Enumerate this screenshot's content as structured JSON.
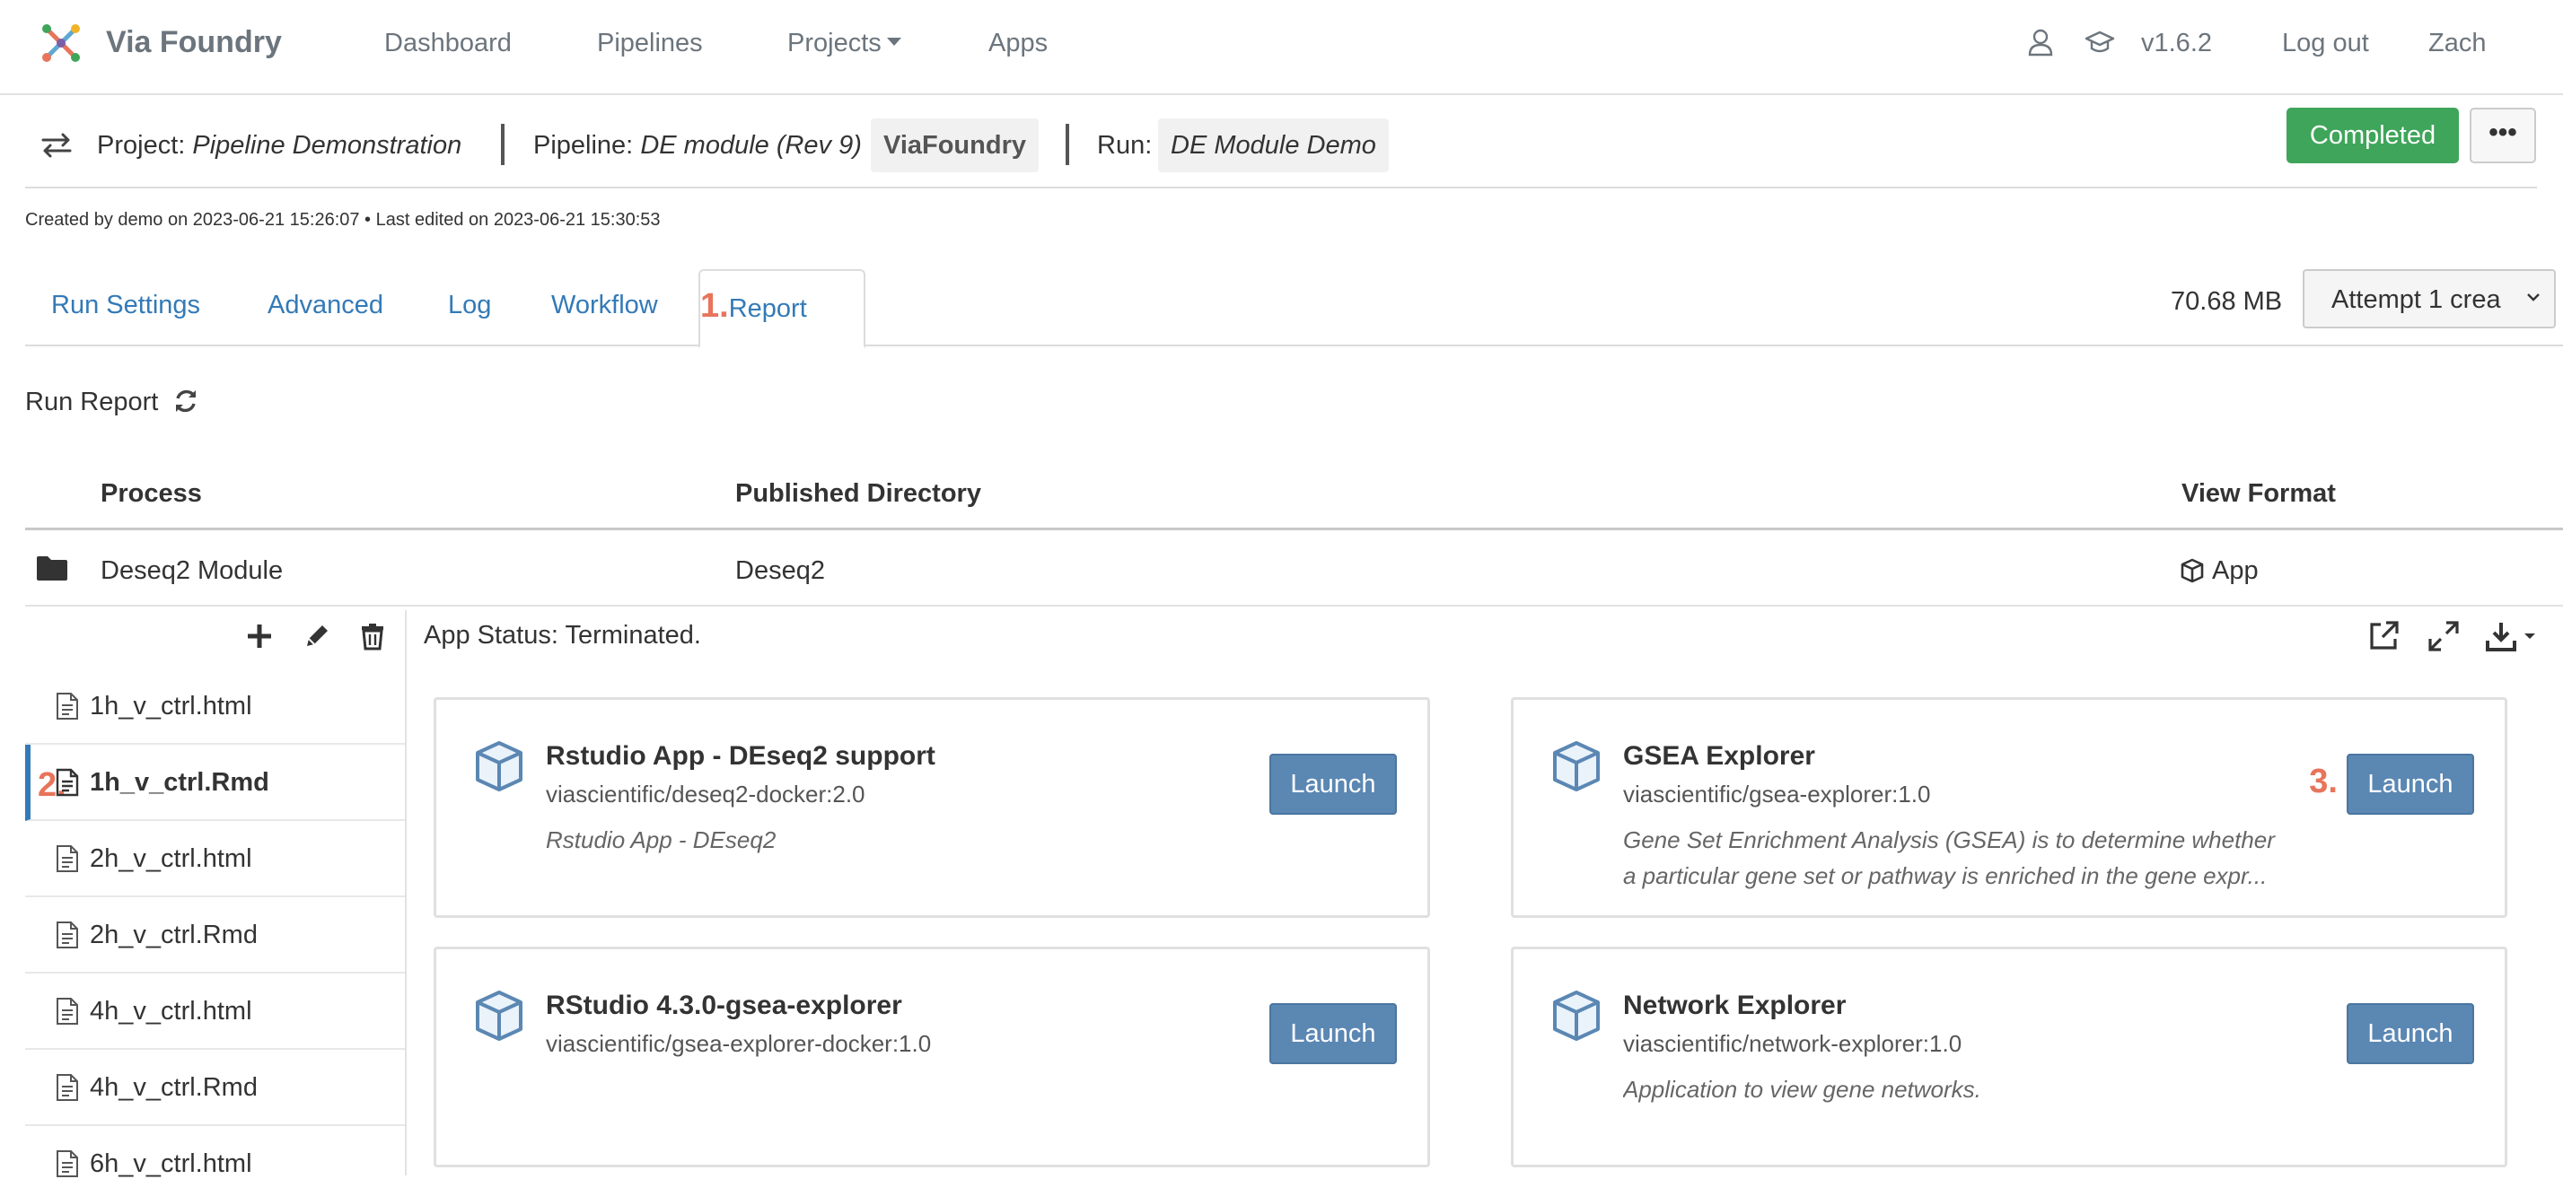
{
  "nav": {
    "brand": "Via Foundry",
    "links": [
      "Dashboard",
      "Pipelines",
      "Projects",
      "Apps"
    ],
    "version": "v1.6.2",
    "logout": "Log out",
    "user": "Zach"
  },
  "project": {
    "project_label": "Project:",
    "project_name": "Pipeline Demonstration",
    "pipeline_label": "Pipeline:",
    "pipeline_name": "DE module (Rev 9)",
    "pipeline_owner": "ViaFoundry",
    "run_label": "Run:",
    "run_name": "DE Module Demo",
    "status": "Completed",
    "more": "•••",
    "meta": "Created by demo on 2023-06-21 15:26:07 • Last edited on 2023-06-21 15:30:53"
  },
  "tabs": [
    "Run Settings",
    "Advanced",
    "Log",
    "Workflow",
    "Report"
  ],
  "markers": {
    "tab": "1.",
    "file": "2.",
    "launch": "3."
  },
  "size": "70.68 MB",
  "attempt": "Attempt 1 crea",
  "report": {
    "title": "Run Report",
    "headers": [
      "Process",
      "Published Directory",
      "View Format"
    ],
    "row": {
      "process": "Deseq2 Module",
      "directory": "Deseq2",
      "format": "App"
    }
  },
  "files": [
    "1h_v_ctrl.html",
    "1h_v_ctrl.Rmd",
    "2h_v_ctrl.html",
    "2h_v_ctrl.Rmd",
    "4h_v_ctrl.html",
    "4h_v_ctrl.Rmd",
    "6h_v_ctrl.html"
  ],
  "app_status": "App Status: Terminated.",
  "apps": [
    {
      "title": "Rstudio App - DEseq2 support",
      "image": "viascientific/deseq2-docker:2.0",
      "desc": [
        "Rstudio App - DEseq2"
      ],
      "launch": "Launch"
    },
    {
      "title": "GSEA Explorer",
      "image": "viascientific/gsea-explorer:1.0",
      "desc": [
        "Gene Set Enrichment Analysis (GSEA) is to determine whether",
        "a particular gene set or pathway is enriched in the gene expr..."
      ],
      "launch": "Launch"
    },
    {
      "title": "RStudio 4.3.0-gsea-explorer",
      "image": "viascientific/gsea-explorer-docker:1.0",
      "desc": [],
      "launch": "Launch"
    },
    {
      "title": "Network Explorer",
      "image": "viascientific/network-explorer:1.0",
      "desc": [
        "Application to view gene networks."
      ],
      "launch": "Launch"
    }
  ],
  "colors": {
    "primary": "#337ab7",
    "success": "#3fa55a",
    "launch": "#5b87b3",
    "marker": "#e8745b"
  }
}
